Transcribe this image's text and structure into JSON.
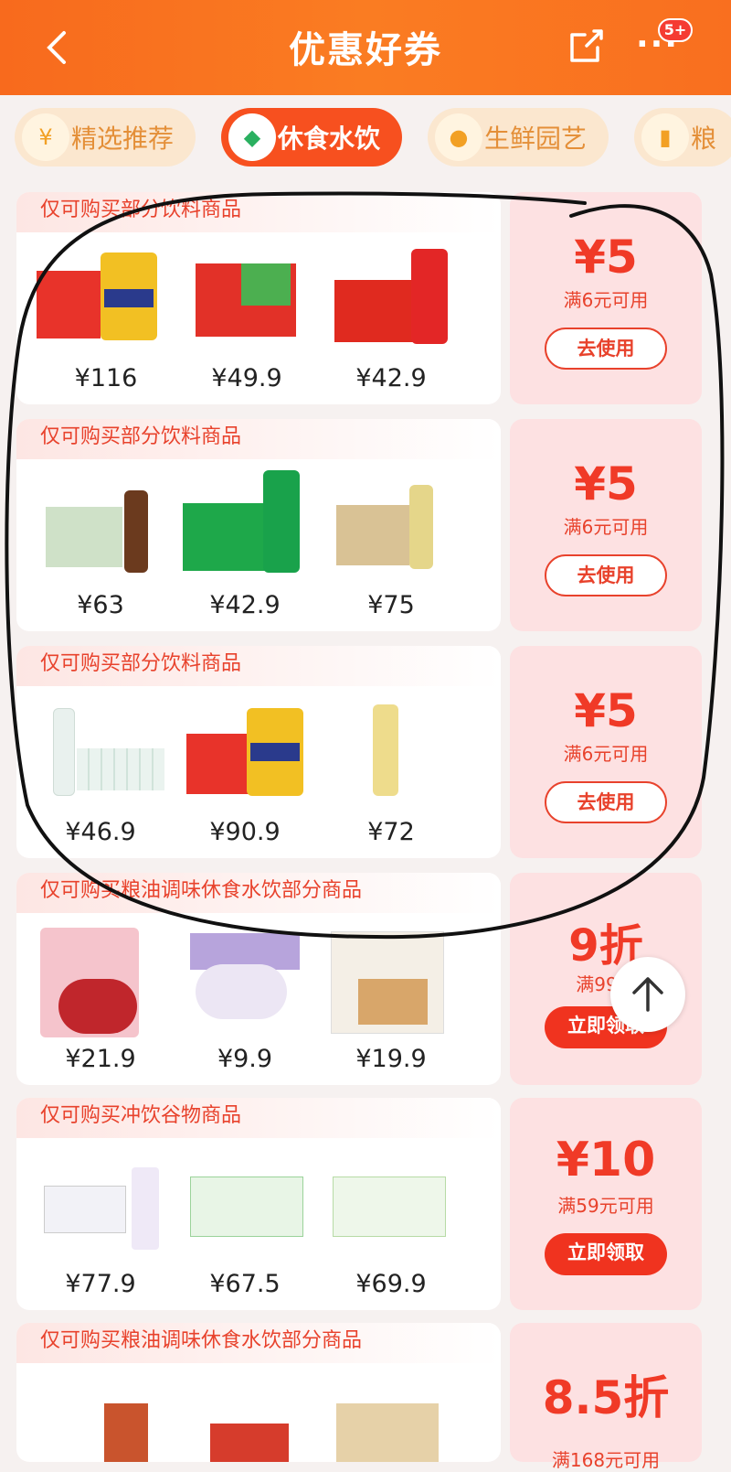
{
  "header": {
    "title": "优惠好券",
    "badge": "5+"
  },
  "tabs": [
    {
      "label": "精选推荐",
      "icon": "coupon-icon"
    },
    {
      "label": "休食水饮",
      "icon": "snack-drink-icon"
    },
    {
      "label": "生鲜园艺",
      "icon": "durian-icon"
    },
    {
      "label": "粮",
      "icon": "grain-icon"
    }
  ],
  "coupons": [
    {
      "caption": "仅可购买部分饮料商品",
      "prices": [
        "¥116",
        "¥49.9",
        "¥42.9"
      ],
      "amount": "¥5",
      "condition": "满6元可用",
      "button": "去使用"
    },
    {
      "caption": "仅可购买部分饮料商品",
      "prices": [
        "¥63",
        "¥42.9",
        "¥75"
      ],
      "amount": "¥5",
      "condition": "满6元可用",
      "button": "去使用"
    },
    {
      "caption": "仅可购买部分饮料商品",
      "prices": [
        "¥46.9",
        "¥90.9",
        "¥72"
      ],
      "amount": "¥5",
      "condition": "满6元可用",
      "button": "去使用"
    },
    {
      "caption": "仅可购买粮油调味休食水饮部分商品",
      "prices": [
        "¥21.9",
        "¥9.9",
        "¥19.9"
      ],
      "amount": "9折",
      "condition": "满99元",
      "button": "立即领取"
    },
    {
      "caption": "仅可购买冲饮谷物商品",
      "prices": [
        "¥77.9",
        "¥67.5",
        "¥69.9"
      ],
      "amount": "¥10",
      "condition": "满59元可用",
      "button": "立即领取"
    },
    {
      "caption": "仅可购买粮油调味休食水饮部分商品",
      "prices": [
        "",
        "",
        ""
      ],
      "amount": "8.5折",
      "condition": "满168元可用",
      "button": ""
    }
  ],
  "colors": {
    "header": "#f86a1d",
    "accent": "#f0331f",
    "coupon_bg": "#fde1e2"
  }
}
